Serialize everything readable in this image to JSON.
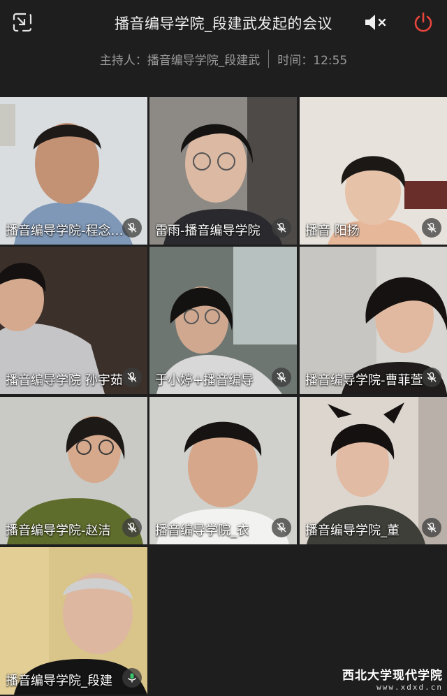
{
  "header": {
    "title": "播音编导学院_段建武发起的会议",
    "host_label": "主持人：播音编导学院_段建武",
    "time_label": "时间：12:55"
  },
  "colors": {
    "background": "#1e1e1e",
    "power": "#e8453c",
    "muted_text": "#9a9a9a"
  },
  "participants": [
    {
      "name": "播音编导学院-程念…",
      "muted": true
    },
    {
      "name": "雷雨-播音编导学院",
      "muted": true
    },
    {
      "name": "播音 阳扬",
      "muted": true
    },
    {
      "name": "播音编导学院 孙宇茹",
      "muted": true
    },
    {
      "name": "于小婷+播音编导",
      "muted": true
    },
    {
      "name": "播音编导学院-曹菲萱",
      "muted": true
    },
    {
      "name": "播音编导学院-赵洁",
      "muted": true
    },
    {
      "name": "播音编导学院_衣",
      "muted": true
    },
    {
      "name": "播音编导学院_董",
      "muted": true
    },
    {
      "name": "播音编导学院_段建",
      "muted": false,
      "speaking": true
    }
  ],
  "watermark": {
    "name": "西北大学现代学院",
    "url": "www.xdxd.cn"
  }
}
